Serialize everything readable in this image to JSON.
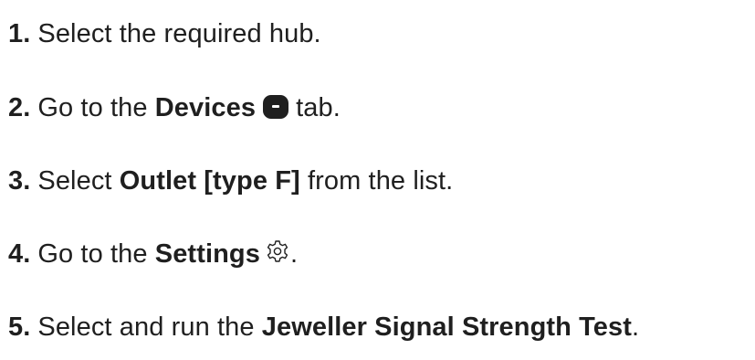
{
  "steps": [
    {
      "number": "1.",
      "text": "Select the required hub."
    },
    {
      "number": "2.",
      "prefix": "Go to the",
      "bold": "Devices",
      "icon": "devices-tab-icon",
      "suffix": "tab."
    },
    {
      "number": "3.",
      "prefix": "Select",
      "bold": "Outlet [type F]",
      "suffix": "from the list."
    },
    {
      "number": "4.",
      "prefix": "Go to the",
      "bold": "Settings",
      "icon": "gear-icon",
      "suffix": "."
    },
    {
      "number": "5.",
      "prefix": "Select and run the",
      "bold": "Jeweller Signal Strength Test",
      "suffix": "."
    }
  ]
}
